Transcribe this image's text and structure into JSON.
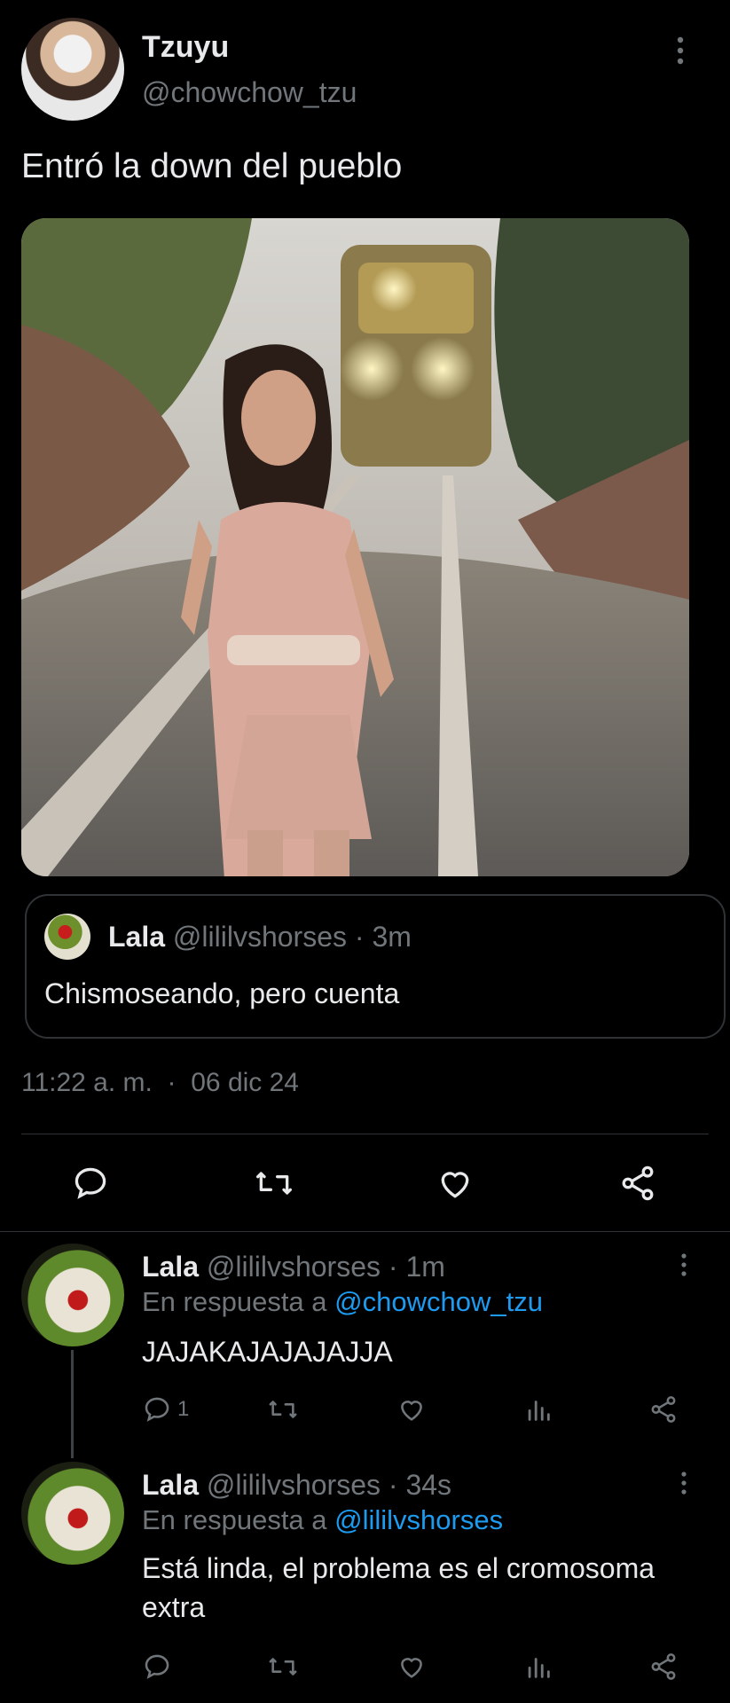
{
  "main_tweet": {
    "author_name": "Tzuyu",
    "author_handle": "@chowchow_tzu",
    "text": "Entró la down del pueblo",
    "quoted": {
      "author_name": "Lala",
      "author_handle": "@lililvshorses",
      "time": "3m",
      "text": "Chismoseando, pero cuenta"
    },
    "time": "11:22 a. m.",
    "date": "06 dic 24"
  },
  "replies": [
    {
      "author_name": "Lala",
      "author_handle": "@lililvshorses",
      "time": "1m",
      "reply_prefix": "En respuesta a",
      "reply_to": "@chowchow_tzu",
      "text": "JAJAKAJAJAJAJJA",
      "reply_count": "1"
    },
    {
      "author_name": "Lala",
      "author_handle": "@lililvshorses",
      "time": "34s",
      "reply_prefix": "En respuesta a",
      "reply_to": "@lililvshorses",
      "text": "Está linda, el problema es el cromosoma extra",
      "reply_count": ""
    }
  ],
  "icons": [
    "more-icon",
    "comment-icon",
    "retweet-icon",
    "like-icon",
    "share-icon",
    "views-icon"
  ],
  "colors": {
    "background": "#000000",
    "text": "#e7e9ea",
    "muted": "#71767b",
    "link": "#1d9bf0"
  }
}
